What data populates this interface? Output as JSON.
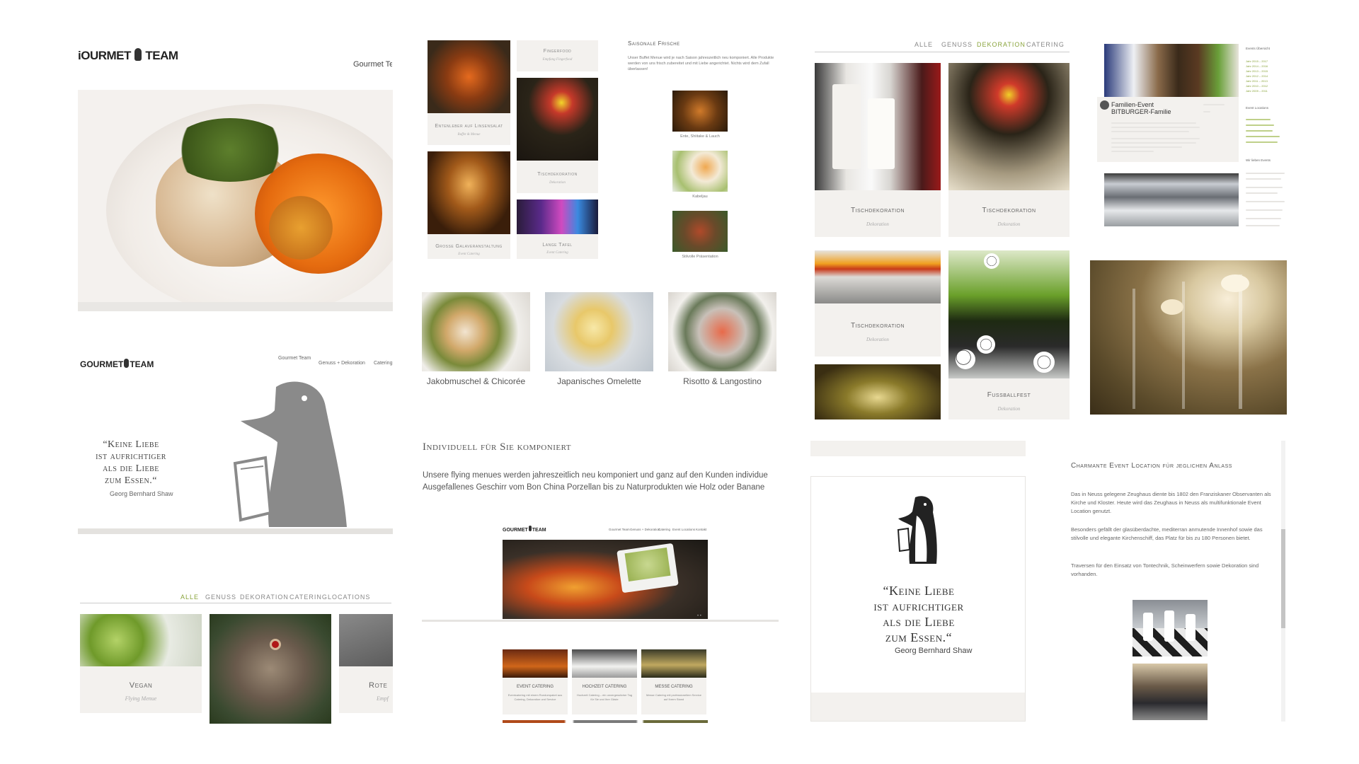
{
  "brand": {
    "logo_text_a": "GOURMET",
    "logo_text_b": "TEAM",
    "logo_cut": "GOURMET",
    "logo_cut_visible": "iOURMET",
    "header_right": "Gourmet Tea"
  },
  "p2": {
    "nav": [
      "Gourmet Team",
      "Genuss + Dekoration",
      "Catering"
    ],
    "quote": "“Keine Liebe ist aufrichtiger als die Liebe zum Essen.“",
    "quote_lines": [
      "“Keine Liebe",
      "ist aufrichtiger",
      "als die Liebe",
      "zum Essen.“"
    ],
    "author": "Georg Bernhard Shaw"
  },
  "p3": {
    "filters": [
      "Alle",
      "Genuss",
      "Dekoration",
      "Catering",
      "Locations"
    ],
    "cards": [
      {
        "title": "Vegan",
        "sub": "Flying Menue"
      },
      {
        "title": "Rote",
        "sub": "Empf"
      }
    ]
  },
  "p4": {
    "tiles": [
      {
        "title": "Fingerfood",
        "sub": "Empfang Fingerfood"
      },
      {
        "title": "Entenleber auf Linsensalat",
        "sub": "Buffet & Menue"
      },
      {
        "title": "Tischdekoration",
        "sub": "Dekoration"
      },
      {
        "title": "Grosse Galaveranstaltung",
        "sub": "Event Catering"
      },
      {
        "title": "Lange Tafel",
        "sub": "Event Catering"
      }
    ],
    "section_title": "Saisonale Frische",
    "section_text": "Unser Buffet Menue wird je nach Saison jahreszeitlich neu komponiert. Alle Produkte werden von uns frisch zubereitet und mit Liebe angerichtet. Nichts wird dem Zufall überlassen!",
    "thumbs": [
      "Ente, Shiitake & Lauch",
      "Kabeljau",
      "Stilvolle Präsentation"
    ]
  },
  "p5": {
    "items": [
      "Jakobmuschel & Chicorée",
      "Japanisches Omelette",
      "Risotto & Langostino"
    ]
  },
  "p6": {
    "title": "Individuell für Sie komponiert",
    "line1": "Unsere flying menues werden jahreszeitlich neu komponiert und ganz auf den Kunden individue",
    "line2": "Ausgefallenes Geschirr vom Bon China Porzellan bis zu Naturprodukten wie Holz oder Banane"
  },
  "p7": {
    "nav": [
      "Gourmet Team",
      "Genuss + Dekoration",
      "Catering",
      "Event Locations",
      "Kontakt"
    ],
    "cards": [
      {
        "title": "Event Catering",
        "text": "Eventcatering mit einem Rundumpaket aus Catering, Dekoration und Service"
      },
      {
        "title": "Hochzeit Catering",
        "text": "Hochzeit Catering – ein unvergesslicher Tag für Sie und Ihre Gäste"
      },
      {
        "title": "Messe Catering",
        "text": "Messe Catering mit professionellem Service auf Ihrem Stand"
      }
    ]
  },
  "p8": {
    "filters": [
      "Alle",
      "Genuss",
      "Dekoration",
      "Catering"
    ],
    "tiles": [
      {
        "title": "Tischdekoration",
        "sub": "Dekoration"
      },
      {
        "title": "Tischdekoration",
        "sub": "Dekoration"
      },
      {
        "title": "Tischdekoration",
        "sub": "Dekoration"
      },
      {
        "title": "Fussballfest",
        "sub": "Dekoration"
      }
    ]
  },
  "p9": {
    "post_title_1": "Familien-Event",
    "post_title_2": "BITBURGER-Familie",
    "side_title": "Events Übersicht",
    "side_links": [
      "Jahr 2015 – 2017",
      "Jahr 2014 – 2016",
      "Jahr 2013 – 2015",
      "Jahr 2012 – 2014",
      "Jahr 2011 – 2013",
      "Jahr 2010 – 2012",
      "Jahr 2009 – 2011"
    ],
    "side_title_2": "Event Locations",
    "side_title_3": "Wir lieben Events"
  },
  "p10": {
    "quote_lines": [
      "“Keine Liebe",
      "ist aufrichtiger",
      "als die Liebe",
      "zum Essen.“"
    ],
    "author": "Georg Bernhard Shaw"
  },
  "p11": {
    "title": "Charmante Event Location für jeglichen Anlass",
    "para1": "Das in Neuss gelegene Zeughaus diente bis 1802 den Franziskaner Observanten als Kirche und Kloster. Heute wird das Zeughaus in Neuss als multifunktionale Event Location genutzt.",
    "para2": "Besonders gefällt der glasüberdachte, mediterran anmutende Innenhof sowie das stilvolle und elegante Kirchenschiff, das Platz für bis zu 180 Personen bietet.",
    "para3": "Traversen für den Einsatz von Tontechnik, Scheinwerfern sowie Dekoration sind vorhanden."
  },
  "colors": {
    "accent": "#8aa43c",
    "card_bg": "#f3f1ee",
    "text": "#555555",
    "penguin": "#8a8a8a"
  }
}
